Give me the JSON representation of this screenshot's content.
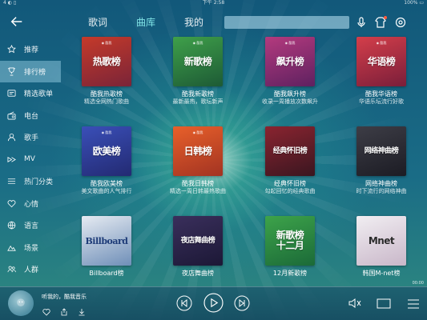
{
  "status_bar": {
    "left": "4 ◐ ▯",
    "time": "下午 2:58",
    "battery": "100% ▭"
  },
  "header": {
    "tabs": [
      {
        "label": "歌词",
        "active": false
      },
      {
        "label": "曲库",
        "active": true
      },
      {
        "label": "我的",
        "active": false
      }
    ],
    "search_placeholder": ""
  },
  "sidebar": {
    "items": [
      {
        "label": "推荐",
        "icon": "star-icon",
        "active": false
      },
      {
        "label": "排行榜",
        "icon": "trophy-icon",
        "active": true
      },
      {
        "label": "精选歌单",
        "icon": "playlist-icon",
        "active": false
      },
      {
        "label": "电台",
        "icon": "radio-icon",
        "active": false
      },
      {
        "label": "歌手",
        "icon": "singer-icon",
        "active": false
      },
      {
        "label": "MV",
        "icon": "video-icon",
        "active": false
      },
      {
        "label": "热门分类",
        "icon": "category-icon",
        "active": false
      },
      {
        "label": "心情",
        "icon": "heart-icon",
        "active": false
      },
      {
        "label": "语言",
        "icon": "globe-icon",
        "active": false
      },
      {
        "label": "场景",
        "icon": "scene-icon",
        "active": false
      },
      {
        "label": "人群",
        "icon": "crowd-icon",
        "active": false
      }
    ]
  },
  "charts": [
    {
      "cover_text": "热歌榜",
      "title": "酷我热歌榜",
      "sub": "精选全网热门歌曲",
      "colors": [
        "#c53a2a",
        "#7a2438"
      ]
    },
    {
      "cover_text": "新歌榜",
      "title": "酷我新歌榜",
      "sub": "最新最热，歌坛新声",
      "colors": [
        "#3fa04a",
        "#1d5a35"
      ]
    },
    {
      "cover_text": "飙升榜",
      "title": "酷我飙升榜",
      "sub": "收录一周播放次数飙升",
      "colors": [
        "#b43a7e",
        "#5e2160"
      ]
    },
    {
      "cover_text": "华语榜",
      "title": "酷我华语榜",
      "sub": "华语乐坛流行好歌",
      "colors": [
        "#d43e4a",
        "#7a1e3a"
      ]
    },
    {
      "cover_text": "欧美榜",
      "title": "酷我欧美榜",
      "sub": "美文歌曲的人气排行",
      "colors": [
        "#3a4fb8",
        "#232a72"
      ]
    },
    {
      "cover_text": "日韩榜",
      "title": "酷我日韩榜",
      "sub": "精选一周日韩最热歌曲",
      "colors": [
        "#e8602a",
        "#a23322"
      ]
    },
    {
      "cover_text": "经典怀旧榜",
      "title": "经典怀旧榜",
      "sub": "勾起回忆的经典歌曲",
      "colors": [
        "#8a2430",
        "#3a1620"
      ]
    },
    {
      "cover_text": "网络神曲榜",
      "title": "网络神曲榜",
      "sub": "时下流行的网络神曲",
      "colors": [
        "#3d3d46",
        "#1c1c24"
      ]
    },
    {
      "cover_text": "Billboard",
      "title": "Billboard榜",
      "sub": "",
      "colors": [
        "#e6ebf2",
        "#6f8fb8"
      ]
    },
    {
      "cover_text": "夜店舞曲榜",
      "title": "夜店舞曲榜",
      "sub": "",
      "colors": [
        "#3a2f5c",
        "#1c1836"
      ]
    },
    {
      "cover_text": "新歌榜 十二月",
      "title": "12月新歌榜",
      "sub": "",
      "colors": [
        "#3da34a",
        "#1b6a38"
      ]
    },
    {
      "cover_text": "Mnet",
      "title": "韩国M-net榜",
      "sub": "",
      "colors": [
        "#f1eef2",
        "#c9b7c9"
      ]
    }
  ],
  "player": {
    "song": "听我的，酷我音乐",
    "time": "00:00",
    "accent": "#7fe3e6"
  }
}
